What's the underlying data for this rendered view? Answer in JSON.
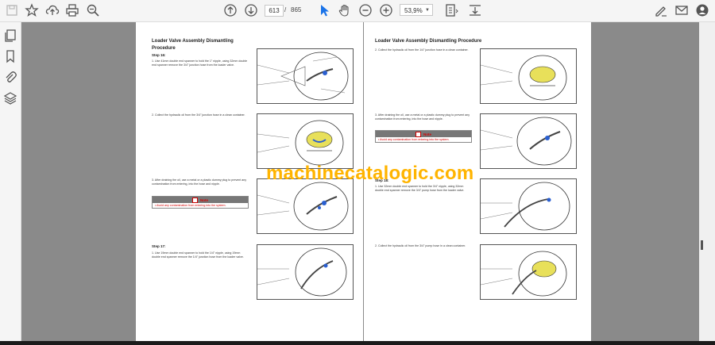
{
  "toolbar": {
    "page_current": "613",
    "page_separator": "/",
    "page_total": "865",
    "zoom": "53,9%"
  },
  "icons": [
    "save-icon",
    "bookmark-star-icon",
    "upload-icon",
    "print-icon",
    "zoom-search-icon",
    "page-up-icon",
    "page-down-icon",
    "select-cursor-icon",
    "hand-icon",
    "zoom-out-icon",
    "zoom-in-icon",
    "page-fit-icon",
    "scroll-mode-icon",
    "sign-icon",
    "email-icon",
    "account-icon"
  ],
  "page_left": {
    "title": "Loader Valve Assembly Dismantling Procedure",
    "step16": "Step 16:",
    "s1": "1.      Use 41mm double end spanner to hold the 1\" nipple, using 32mm double end spanner remove the 3/4\" junction hose from the loader valve.",
    "s2": "2.      Collect the hydraulic oil from the 3/4\" junction hose in a clean container.",
    "s3": "3.      After draining the oil, use a metal or a plastic dummy plug to prevent any contamination from entering, into the hose and nipple.",
    "note_label": "Note",
    "note_text": "•   Avoid any contamination from entering into the system.",
    "step17": "Step 17:",
    "s4": "1.      Use 19mm double end spanner to hold the 1/4\" nipple, using 19mm double end spanner remove the 1/4\" junction hose from the loader valve."
  },
  "page_right": {
    "title": "Loader Valve Assembly Dismantling Procedure",
    "s1": "2.      Collect the hydraulic oil from the 1/4\" junction hose in a clean container.",
    "s2": "3.      After draining the oil, use a metal or a plastic dummy plug to prevent any contamination from entering, into the hose and nipple.",
    "note_label": "Note",
    "note_text": "•   Avoid any contamination from entering into the system.",
    "step18": "Step 18:",
    "s3": "1.      Use 32mm double end spanner to hold the 3/4\" nipple, using 32mm double end spanner remove the 3/4\" pump hose from the loader valve.",
    "s4": "2.      Collect the hydraulic oil from the 3/4\" pump hose in a clean container."
  },
  "watermark": "machinecatalogic.com"
}
